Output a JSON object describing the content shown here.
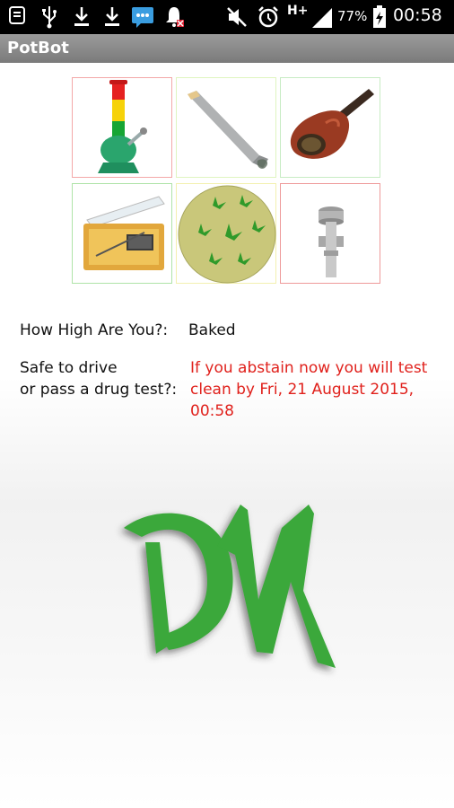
{
  "status_bar": {
    "battery": "77%",
    "time": "00:58",
    "network": "H+",
    "icons": [
      "notification-app-icon",
      "usb-icon",
      "download-icon",
      "download-icon",
      "messaging-icon",
      "alarm-muted-bell-icon",
      "silent-icon",
      "alarm-clock-icon",
      "signal-icon",
      "battery-charging-icon"
    ]
  },
  "app": {
    "title": "PotBot"
  },
  "grid": {
    "tiles": [
      {
        "name": "bong",
        "border": "#f3a8a8"
      },
      {
        "name": "joint",
        "border": "#dff5c0"
      },
      {
        "name": "pipe",
        "border": "#c7ecc3"
      },
      {
        "name": "vaporizer",
        "border": "#aee3a8"
      },
      {
        "name": "edible",
        "border": "#f3f0b0"
      },
      {
        "name": "dab-nail",
        "border": "#ee9a9a"
      }
    ]
  },
  "status": {
    "high_label": "How High Are You?:",
    "high_value": "Baked",
    "drive_label_line1": "Safe to drive",
    "drive_label_line2": "or pass a drug test?:",
    "drive_value_line1": "If you abstain now you will test",
    "drive_value_line2": "clean by Fri, 21 August 2015,",
    "drive_value_line3": "00:58"
  },
  "logo": {
    "text": "DM",
    "color": "#3aa83a"
  }
}
